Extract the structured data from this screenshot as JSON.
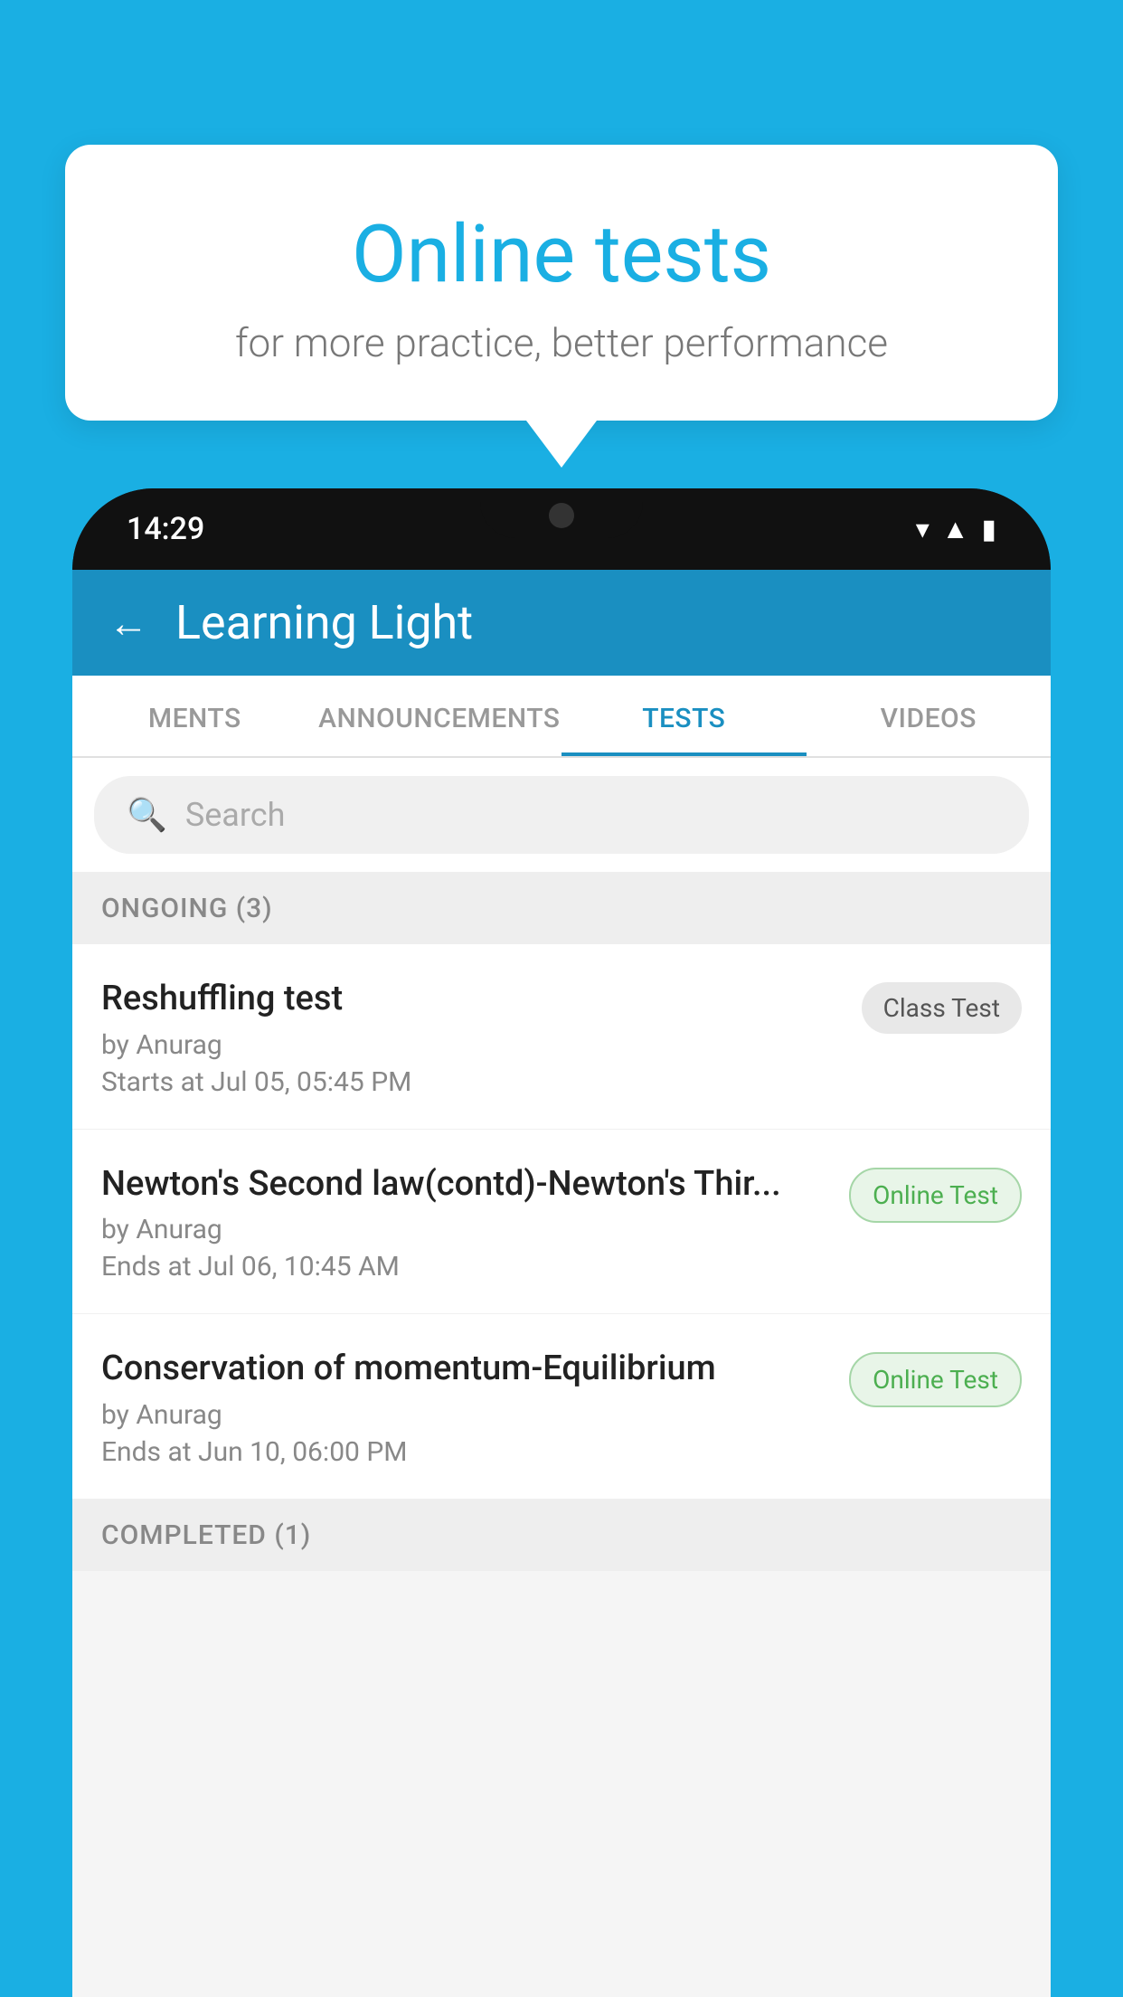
{
  "background_color": "#1AAFE3",
  "speech_bubble": {
    "title": "Online tests",
    "subtitle": "for more practice, better performance"
  },
  "phone": {
    "status_bar": {
      "time": "14:29",
      "icons": [
        "wifi",
        "signal",
        "battery"
      ]
    },
    "header": {
      "back_label": "←",
      "title": "Learning Light"
    },
    "tabs": [
      {
        "label": "MENTS",
        "active": false
      },
      {
        "label": "ANNOUNCEMENTS",
        "active": false
      },
      {
        "label": "TESTS",
        "active": true
      },
      {
        "label": "VIDEOS",
        "active": false
      }
    ],
    "search": {
      "placeholder": "Search"
    },
    "ongoing_section": {
      "title": "ONGOING (3)",
      "tests": [
        {
          "name": "Reshuffling test",
          "by": "by Anurag",
          "time": "Starts at  Jul 05, 05:45 PM",
          "badge": "Class Test",
          "badge_type": "class"
        },
        {
          "name": "Newton's Second law(contd)-Newton's Thir...",
          "by": "by Anurag",
          "time": "Ends at  Jul 06, 10:45 AM",
          "badge": "Online Test",
          "badge_type": "online"
        },
        {
          "name": "Conservation of momentum-Equilibrium",
          "by": "by Anurag",
          "time": "Ends at  Jun 10, 06:00 PM",
          "badge": "Online Test",
          "badge_type": "online"
        }
      ]
    },
    "completed_section": {
      "title": "COMPLETED (1)"
    }
  }
}
